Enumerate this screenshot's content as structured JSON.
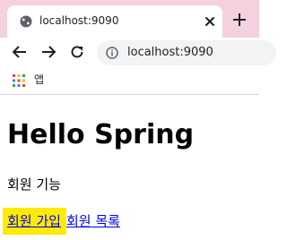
{
  "tab": {
    "title": "localhost:9090",
    "favicon": "globe-icon",
    "close": "close-icon"
  },
  "toolbar": {
    "back": "arrow-left-icon",
    "forward": "arrow-right-icon",
    "reload": "reload-icon",
    "url": "localhost:9090",
    "site_info": "info-icon"
  },
  "bookmarks": {
    "apps_label": "앱",
    "apps_icon": "apps-grid-icon"
  },
  "page": {
    "heading": "Hello Spring",
    "section_label": "회원 기능",
    "links": [
      {
        "label": "회원 가입"
      },
      {
        "label": "회원 목록"
      }
    ]
  },
  "colors": {
    "tabstrip_bg": "#f5d1e0",
    "omnibox_bg": "#f1f3f4",
    "link": "#0000ee",
    "highlight": "#ffea00"
  }
}
